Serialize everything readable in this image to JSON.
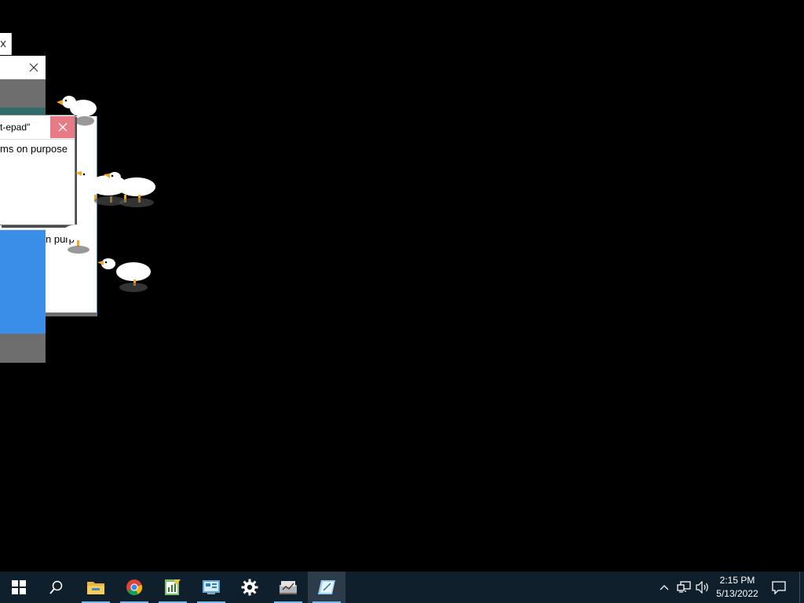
{
  "windows": {
    "note_title": "t-epad\"",
    "note_body": "ms on purpose",
    "behind_text": "n purp"
  },
  "geese": [
    "goose",
    "goose",
    "goose",
    "goose",
    "goose"
  ],
  "taskbar": {
    "start": "windows-start-icon",
    "search": "search-icon",
    "apps": [
      {
        "name": "file-explorer-icon",
        "running": true
      },
      {
        "name": "chrome-icon",
        "running": true
      },
      {
        "name": "spreadsheet-icon",
        "running": true
      },
      {
        "name": "control-panel-icon",
        "running": true
      },
      {
        "name": "settings-gear-icon",
        "running": false
      },
      {
        "name": "network-drive-icon",
        "running": true
      },
      {
        "name": "notepad-icon",
        "running": true,
        "active": true
      }
    ],
    "tray": {
      "time": "2:15 PM",
      "date": "5/13/2022"
    }
  },
  "colors": {
    "desktop": "#000000",
    "taskbar": "#101f2c",
    "accent": "#3b8ee8",
    "close_hover": "#e87a86",
    "goose_beak": "#f5a623"
  }
}
